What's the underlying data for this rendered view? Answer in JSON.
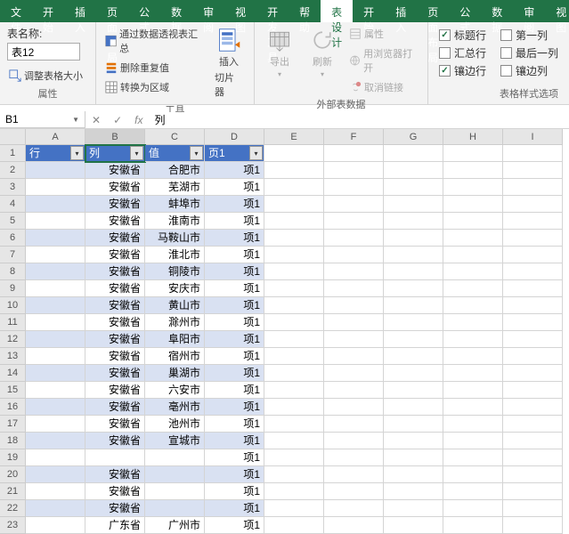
{
  "menu": {
    "file": "文件",
    "tabs": [
      "开始",
      "插入",
      "页面布局",
      "公式",
      "数据",
      "审阅",
      "视图",
      "开发工具",
      "帮助",
      "表设计"
    ],
    "active_index": 9
  },
  "ribbon": {
    "props": {
      "title": "表名称:",
      "table_name": "表12",
      "resize": "调整表格大小",
      "group": "属性"
    },
    "tools": {
      "pivot": "通过数据透视表汇总",
      "dedup": "删除重复值",
      "convert": "转换为区域",
      "slicer_top": "插入",
      "slicer_bot": "切片器",
      "group": "工具"
    },
    "ext": {
      "export": "导出",
      "refresh": "刷新",
      "props": "属性",
      "browser": "用浏览器打开",
      "unlink": "取消链接",
      "group": "外部表数据"
    },
    "styleopts": {
      "header_row": "标题行",
      "total_row": "汇总行",
      "banded_rows": "镶边行",
      "first_col": "第一列",
      "last_col": "最后一列",
      "banded_cols": "镶边列",
      "group": "表格样式选项"
    }
  },
  "namebox": "B1",
  "formula": "列",
  "cols": [
    "A",
    "B",
    "C",
    "D",
    "E",
    "F",
    "G",
    "H",
    "I"
  ],
  "headers": [
    "行",
    "列",
    "值",
    "页1"
  ],
  "chart_data": {
    "type": "table",
    "columns": [
      "行",
      "列",
      "值",
      "页1"
    ],
    "rows": [
      [
        "",
        "安徽省",
        "合肥市",
        "项1"
      ],
      [
        "",
        "安徽省",
        "芜湖市",
        "项1"
      ],
      [
        "",
        "安徽省",
        "蚌埠市",
        "项1"
      ],
      [
        "",
        "安徽省",
        "淮南市",
        "项1"
      ],
      [
        "",
        "安徽省",
        "马鞍山市",
        "项1"
      ],
      [
        "",
        "安徽省",
        "淮北市",
        "项1"
      ],
      [
        "",
        "安徽省",
        "铜陵市",
        "项1"
      ],
      [
        "",
        "安徽省",
        "安庆市",
        "项1"
      ],
      [
        "",
        "安徽省",
        "黄山市",
        "项1"
      ],
      [
        "",
        "安徽省",
        "滁州市",
        "项1"
      ],
      [
        "",
        "安徽省",
        "阜阳市",
        "项1"
      ],
      [
        "",
        "安徽省",
        "宿州市",
        "项1"
      ],
      [
        "",
        "安徽省",
        "巢湖市",
        "项1"
      ],
      [
        "",
        "安徽省",
        "六安市",
        "项1"
      ],
      [
        "",
        "安徽省",
        "亳州市",
        "项1"
      ],
      [
        "",
        "安徽省",
        "池州市",
        "项1"
      ],
      [
        "",
        "安徽省",
        "宣城市",
        "项1"
      ],
      [
        "",
        "",
        "",
        "项1"
      ],
      [
        "",
        "安徽省",
        "",
        "项1"
      ],
      [
        "",
        "安徽省",
        "",
        "项1"
      ],
      [
        "",
        "安徽省",
        "",
        "项1"
      ],
      [
        "",
        "广东省",
        "广州市",
        "项1"
      ]
    ]
  }
}
